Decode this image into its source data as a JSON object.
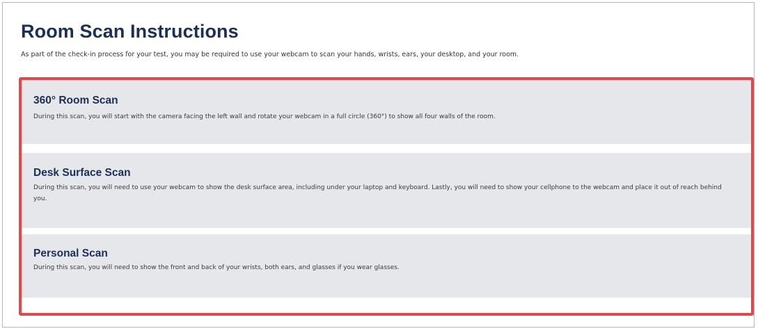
{
  "page": {
    "title": "Room Scan Instructions",
    "intro": "As part of the check-in process for your test, you may be required to use your webcam to scan your hands, wrists, ears, your desktop, and your room."
  },
  "sections": [
    {
      "heading": "360° Room Scan",
      "text": "During this scan, you will start with the camera facing the left wall and rotate your webcam in a full circle (360°) to show all four walls of the room."
    },
    {
      "heading": "Desk Surface Scan",
      "text": "During this scan, you will need to use your webcam to show the desk surface area, including under your laptop and keyboard. Lastly, you will need to show your cellphone to the webcam and place it out of reach behind you."
    },
    {
      "heading": "Personal Scan",
      "text": "During this scan, you will need to show the front and back of your wrists, both ears, and glasses if you wear glasses."
    }
  ],
  "colors": {
    "heading": "#1b2f57",
    "panel_background": "#e6e7ea",
    "highlight_border": "#e2474e"
  }
}
